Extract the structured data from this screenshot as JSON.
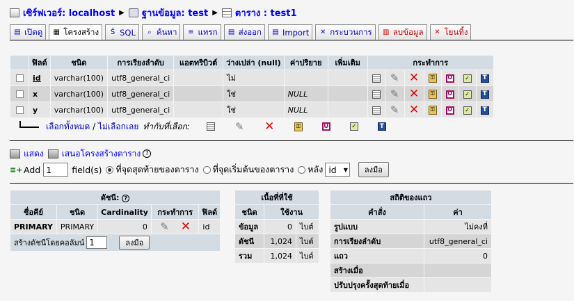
{
  "breadcrumb": {
    "server_label": "เซิร์ฟเวอร์: localhost",
    "db_label": "ฐานข้อมูล: test",
    "table_label": "ตาราง : test1"
  },
  "tabs": [
    {
      "label": "เปิดดู",
      "icon": "browse-icon",
      "glyph": "▤"
    },
    {
      "label": "โครงสร้าง",
      "icon": "structure-icon",
      "glyph": "▦",
      "active": true
    },
    {
      "label": "SQL",
      "icon": "sql-icon",
      "glyph": "Ŝ"
    },
    {
      "label": "ค้นหา",
      "icon": "search-icon",
      "glyph": "⌕"
    },
    {
      "label": "แทรก",
      "icon": "insert-icon",
      "glyph": "≡"
    },
    {
      "label": "ส่งออก",
      "icon": "export-icon",
      "glyph": "▤"
    },
    {
      "label": "Import",
      "icon": "import-icon",
      "glyph": "▤"
    },
    {
      "label": "กระบวนการ",
      "icon": "operations-icon",
      "glyph": "✕"
    },
    {
      "label": "ลบข้อมูล",
      "icon": "empty-icon",
      "glyph": "▥",
      "red": true
    },
    {
      "label": "โยนทิ้ง",
      "icon": "drop-icon",
      "glyph": "✕",
      "red": true
    }
  ],
  "structure": {
    "headers": [
      "ฟิลด์",
      "ชนิด",
      "การเรียงลำดับ",
      "แอตทริบิวต์",
      "ว่างเปล่า (null)",
      "ค่าปริยาย",
      "เพิ่มเติม",
      "กระทำการ"
    ],
    "rows": [
      {
        "field": "id",
        "type": "varchar(100)",
        "collation": "utf8_general_ci",
        "attributes": "",
        "null": "ไม่",
        "default": "",
        "extra": "",
        "primary": true
      },
      {
        "field": "x",
        "type": "varchar(100)",
        "collation": "utf8_general_ci",
        "attributes": "",
        "null": "ใช่",
        "default": "NULL",
        "extra": ""
      },
      {
        "field": "y",
        "type": "varchar(100)",
        "collation": "utf8_general_ci",
        "attributes": "",
        "null": "ใช่",
        "default": "NULL",
        "extra": ""
      }
    ]
  },
  "check_all": {
    "check_all": "เลือกทั้งหมด",
    "sep": " / ",
    "uncheck_all": "ไม่เลือกเลย",
    "with_selected": "ทำกับที่เลือก:"
  },
  "links": {
    "print": "แสดง",
    "propose": "เสนอโครงสร้างตาราง"
  },
  "add_field": {
    "add": "Add",
    "count": "1",
    "fields_label": "field(s)",
    "opt_end": "ที่จุดสุดท้ายของตาราง",
    "opt_begin": "ที่จุดเริ่มต้นของตาราง",
    "opt_after": "หลัง",
    "after_value": "id",
    "go": "ลงมือ"
  },
  "indexes": {
    "caption": "ดัชนี:",
    "headers": [
      "ชื่อคีย์",
      "ชนิด",
      "Cardinality",
      "กระทำการ",
      "ฟิลด์"
    ],
    "row": {
      "key": "PRIMARY",
      "type": "PRIMARY",
      "cardinality": "0",
      "field": "id"
    },
    "create_label": "สร้างดัชนีโดยคอลัมน์",
    "create_count": "1",
    "create_go": "ลงมือ"
  },
  "space": {
    "caption": "เนื้อที่ที่ใช้",
    "headers": [
      "ชนิด",
      "ใช้งาน"
    ],
    "rows": [
      {
        "type": "ข้อมูล",
        "value": "0",
        "unit": "ไบต์"
      },
      {
        "type": "ดัชนี",
        "value": "1,024",
        "unit": "ไบต์"
      },
      {
        "type": "รวม",
        "value": "1,024",
        "unit": "ไบต์"
      }
    ]
  },
  "row_stats": {
    "caption": "สถิติของแถว",
    "headers": [
      "คำสั่ง",
      "ค่า"
    ],
    "rows": [
      {
        "label": "รูปแบบ",
        "value": "ไม่คงที่"
      },
      {
        "label": "การเรียงลำดับ",
        "value": "utf8_general_ci"
      },
      {
        "label": "แถว",
        "value": "0"
      },
      {
        "label": "สร้างเมื่อ",
        "value": ""
      },
      {
        "label": "ปรับปรุงครั้งสุดท้ายเมื่อ",
        "value": ""
      }
    ]
  }
}
